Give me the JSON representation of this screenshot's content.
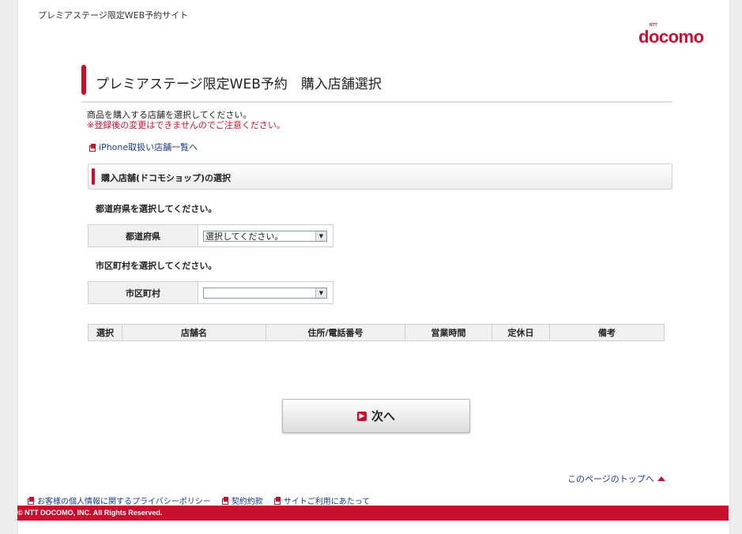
{
  "header": {
    "site_name": "プレミアステージ限定WEB予約サイト",
    "logo_small": "NTT",
    "logo_text": "docomo"
  },
  "title": "プレミアステージ限定WEB予約　購入店舗選択",
  "instructions": {
    "line1": "商品を購入する店舗を選択してください。",
    "line2": "※登録後の変更はできませんのでご注意ください。"
  },
  "iphone_link": "iPhone取扱い店舗一覧へ",
  "section_title": "購入店舗(ドコモショップ)の選択",
  "prefecture": {
    "prompt": "都道府県を選択してください。",
    "label": "都道府県",
    "selected": "選択してください。"
  },
  "city": {
    "prompt": "市区町村を選択してください。",
    "label": "市区町村",
    "selected": ""
  },
  "table": {
    "headers": [
      "選択",
      "店舗名",
      "住所/電話番号",
      "営業時間",
      "定休日",
      "備考"
    ]
  },
  "next_button": "次へ",
  "page_top_link": "このページのトップへ",
  "footer": {
    "links": [
      "お客様の個人情報に関するプライバシーポリシー",
      "契約約款",
      "サイトご利用にあたって"
    ],
    "copyright": "© NTT DOCOMO, INC. All Rights Reserved."
  },
  "colors": {
    "brand_red": "#c8102e",
    "link_blue": "#1a3a8f"
  }
}
